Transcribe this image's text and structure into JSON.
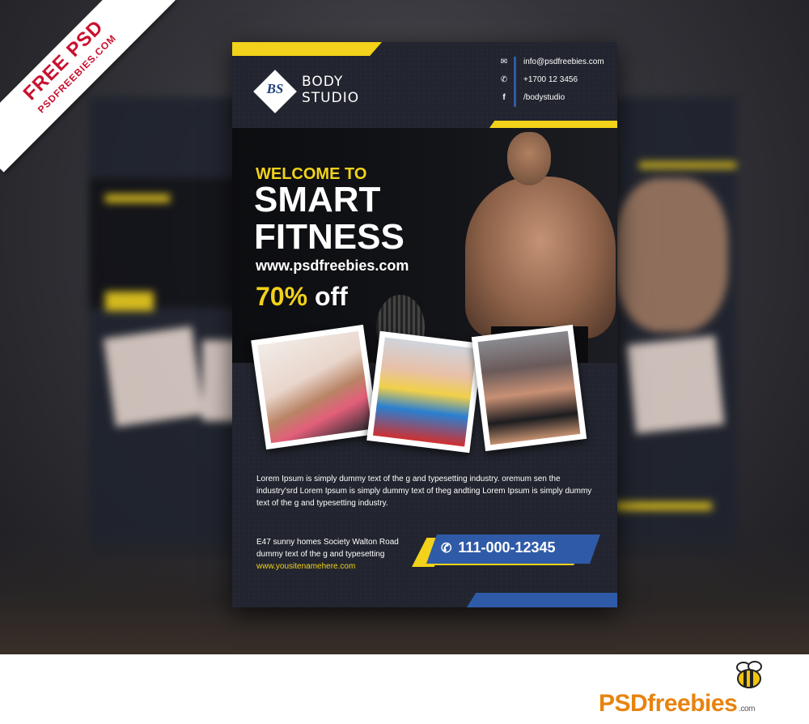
{
  "ribbon": {
    "line1": "FREE PSD",
    "line2": "PSDFREEBIES.COM"
  },
  "flyer": {
    "logo_initials": "BS",
    "brand_line1": "BODY",
    "brand_line2": "STUDIO",
    "contacts": [
      {
        "icon": "envelope-icon",
        "text": "info@psdfreebies.com"
      },
      {
        "icon": "phone-icon",
        "text": "+1700 12 3456"
      },
      {
        "icon": "facebook-icon",
        "text": "/bodystudio"
      }
    ],
    "welcome": "WELCOME TO",
    "headline1": "SMART",
    "headline2": "FITNESS",
    "website": "www.psdfreebies.com",
    "discount_pct": "70%",
    "discount_word": "off",
    "body_text": "Lorem Ipsum is simply dummy text of the g and typesetting industry. oremum sen the industry'srd Lorem Ipsum is simply dummy text of theg andting Lorem Ipsum is simply dummy text of the g and typesetting industry.",
    "address_line1": "E47 sunny homes Society Walton Road",
    "address_line2": "dummy text of the g and typesetting",
    "address_web": "www.yousitenamehere.com",
    "phone": "111-000-12345"
  },
  "footer": {
    "brand": "PSDfreebies",
    "domain": ".com"
  },
  "colors": {
    "accent_yellow": "#f2d21a",
    "accent_blue": "#2f5aa8",
    "flyer_bg": "#22252f",
    "brand_orange": "#e8830e",
    "ribbon_red": "#c8102e"
  }
}
